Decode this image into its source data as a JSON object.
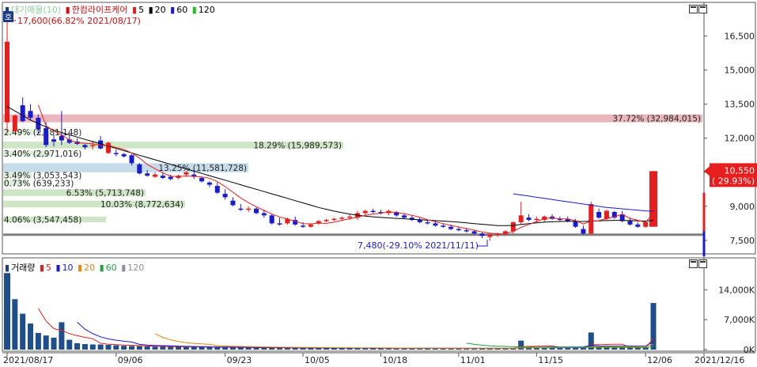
{
  "chart_data": [
    {
      "type": "candlestick",
      "title": "한컴라이프케어",
      "legend": {
        "prefix_label": "대기매물(10)",
        "name": "한컴라이프케어",
        "ma": [
          {
            "label": "5",
            "color": "#e02020"
          },
          {
            "label": "20",
            "color": "#000000"
          },
          {
            "label": "60",
            "color": "#1a1ad0"
          },
          {
            "label": "120",
            "color": "#20c020"
          }
        ]
      },
      "high_note": "17,600(66.82% 2021/08/17)",
      "low_note": "7,480(-29.10% 2021/11/11)",
      "current_price": "10,550",
      "current_change": "( 29.93%)",
      "y_ticks": [
        "16,500",
        "15,000",
        "13,500",
        "12,000",
        "10,500",
        "9,000",
        "7,500"
      ],
      "y_tick_values": [
        16500,
        15000,
        13500,
        12000,
        10500,
        9000,
        7500
      ],
      "ylim": [
        6800,
        17600
      ],
      "x_ticks": [
        "2021/08/17",
        "09/06",
        "09/23",
        "10/05",
        "10/18",
        "11/01",
        "11/15",
        "12/06",
        "2021/12/16"
      ],
      "volume_profile": [
        {
          "low": 12700,
          "high": 13050,
          "text": "37.72% (32,984,015)",
          "label_align": "right",
          "color": "#eab8bc"
        },
        {
          "low": 11550,
          "high": 11850,
          "text": "18.29% (15,989,573)",
          "label_align": "right",
          "color": "#cfe6c6"
        },
        {
          "low": 10500,
          "high": 10900,
          "text": "13.25% (11,581,728)",
          "label_align": "right",
          "color": "#c6dcea"
        },
        {
          "low": 12150,
          "high": 12400,
          "text": "2.49% (2,181,148)",
          "label_align": "left",
          "color": "#dfeeda"
        },
        {
          "low": 11200,
          "high": 11450,
          "text": "3.40% (2,971,016)",
          "label_align": "left",
          "color": "#dfeeda"
        },
        {
          "low": 10250,
          "high": 10500,
          "text": "3.49% (3,053,543)",
          "label_align": "left",
          "color": "#dfeeda"
        },
        {
          "low": 9900,
          "high": 10150,
          "text": "0.73% (639,233)",
          "label_align": "left",
          "color": "#dfeeda"
        },
        {
          "low": 9450,
          "high": 9750,
          "text": "6.53% (5,713,748)",
          "label_align": "right",
          "color": "#cfe6c6"
        },
        {
          "low": 8950,
          "high": 9250,
          "text": "10.03% (8,772,634)",
          "label_align": "right",
          "color": "#cfe6c6"
        },
        {
          "low": 8300,
          "high": 8550,
          "text": "4.06% (3,547,458)",
          "label_align": "left",
          "color": "#cfe6c6"
        }
      ],
      "support_line": 7750,
      "candles": [
        {
          "o": 12700,
          "h": 17600,
          "l": 12300,
          "c": 16250
        },
        {
          "o": 12300,
          "h": 13050,
          "l": 12300,
          "c": 13000
        },
        {
          "o": 13450,
          "h": 13800,
          "l": 12700,
          "c": 12750
        },
        {
          "o": 13200,
          "h": 13500,
          "l": 12800,
          "c": 12900
        },
        {
          "o": 12900,
          "h": 13050,
          "l": 12200,
          "c": 12400
        },
        {
          "o": 12450,
          "h": 12700,
          "l": 11600,
          "c": 11700
        },
        {
          "o": 11950,
          "h": 12150,
          "l": 11650,
          "c": 11850
        },
        {
          "o": 12100,
          "h": 13200,
          "l": 11700,
          "c": 11900
        },
        {
          "o": 11950,
          "h": 12150,
          "l": 11750,
          "c": 11800
        },
        {
          "o": 11850,
          "h": 12000,
          "l": 11700,
          "c": 11750
        },
        {
          "o": 11700,
          "h": 11750,
          "l": 11500,
          "c": 11600
        },
        {
          "o": 11650,
          "h": 11850,
          "l": 11500,
          "c": 11700
        },
        {
          "o": 11900,
          "h": 12100,
          "l": 11500,
          "c": 11550
        },
        {
          "o": 11350,
          "h": 11850,
          "l": 11300,
          "c": 11800
        },
        {
          "o": 11350,
          "h": 11500,
          "l": 11200,
          "c": 11300
        },
        {
          "o": 11300,
          "h": 11350,
          "l": 11150,
          "c": 11200
        },
        {
          "o": 11250,
          "h": 11300,
          "l": 10800,
          "c": 10900
        },
        {
          "o": 10850,
          "h": 10900,
          "l": 10400,
          "c": 10450
        },
        {
          "o": 10450,
          "h": 10600,
          "l": 10300,
          "c": 10350
        },
        {
          "o": 10300,
          "h": 10500,
          "l": 10250,
          "c": 10400
        },
        {
          "o": 10350,
          "h": 10500,
          "l": 10200,
          "c": 10250
        },
        {
          "o": 10300,
          "h": 10400,
          "l": 10150,
          "c": 10200
        },
        {
          "o": 10250,
          "h": 10400,
          "l": 10200,
          "c": 10350
        },
        {
          "o": 10400,
          "h": 10550,
          "l": 10300,
          "c": 10500
        },
        {
          "o": 10400,
          "h": 10600,
          "l": 10200,
          "c": 10300
        },
        {
          "o": 10250,
          "h": 10300,
          "l": 10050,
          "c": 10100
        },
        {
          "o": 10050,
          "h": 10100,
          "l": 9850,
          "c": 9950
        },
        {
          "o": 9900,
          "h": 10050,
          "l": 9550,
          "c": 9600
        },
        {
          "o": 9550,
          "h": 9750,
          "l": 9300,
          "c": 9400
        },
        {
          "o": 9250,
          "h": 9400,
          "l": 9000,
          "c": 9050
        },
        {
          "o": 8900,
          "h": 9100,
          "l": 8800,
          "c": 8850
        },
        {
          "o": 8850,
          "h": 9000,
          "l": 8750,
          "c": 8900
        },
        {
          "o": 8900,
          "h": 8950,
          "l": 8650,
          "c": 8700
        },
        {
          "o": 8700,
          "h": 8850,
          "l": 8500,
          "c": 8600
        },
        {
          "o": 8600,
          "h": 8650,
          "l": 8200,
          "c": 8250
        },
        {
          "o": 8250,
          "h": 8500,
          "l": 8150,
          "c": 8200
        },
        {
          "o": 8250,
          "h": 8500,
          "l": 8200,
          "c": 8450
        },
        {
          "o": 8400,
          "h": 8550,
          "l": 8150,
          "c": 8200
        },
        {
          "o": 8150,
          "h": 8300,
          "l": 8050,
          "c": 8100
        },
        {
          "o": 8100,
          "h": 8250,
          "l": 8050,
          "c": 8200
        },
        {
          "o": 8250,
          "h": 8400,
          "l": 8200,
          "c": 8350
        },
        {
          "o": 8350,
          "h": 8450,
          "l": 8300,
          "c": 8400
        },
        {
          "o": 8400,
          "h": 8500,
          "l": 8350,
          "c": 8450
        },
        {
          "o": 8450,
          "h": 8550,
          "l": 8350,
          "c": 8500
        },
        {
          "o": 8500,
          "h": 8650,
          "l": 8400,
          "c": 8550
        },
        {
          "o": 8500,
          "h": 8800,
          "l": 8400,
          "c": 8700
        },
        {
          "o": 8700,
          "h": 8850,
          "l": 8600,
          "c": 8800
        },
        {
          "o": 8800,
          "h": 8900,
          "l": 8700,
          "c": 8750
        },
        {
          "o": 8750,
          "h": 8850,
          "l": 8650,
          "c": 8700
        },
        {
          "o": 8700,
          "h": 8850,
          "l": 8600,
          "c": 8800
        },
        {
          "o": 8750,
          "h": 8800,
          "l": 8550,
          "c": 8600
        },
        {
          "o": 8600,
          "h": 8700,
          "l": 8450,
          "c": 8500
        },
        {
          "o": 8500,
          "h": 8600,
          "l": 8350,
          "c": 8400
        },
        {
          "o": 8400,
          "h": 8500,
          "l": 8250,
          "c": 8300
        },
        {
          "o": 8300,
          "h": 8400,
          "l": 8200,
          "c": 8250
        },
        {
          "o": 8250,
          "h": 8350,
          "l": 8100,
          "c": 8150
        },
        {
          "o": 8150,
          "h": 8250,
          "l": 8050,
          "c": 8100
        },
        {
          "o": 8100,
          "h": 8200,
          "l": 7950,
          "c": 8000
        },
        {
          "o": 8000,
          "h": 8100,
          "l": 7900,
          "c": 7950
        },
        {
          "o": 7950,
          "h": 8050,
          "l": 7850,
          "c": 7900
        },
        {
          "o": 7900,
          "h": 7950,
          "l": 7750,
          "c": 7800
        },
        {
          "o": 7800,
          "h": 7850,
          "l": 7600,
          "c": 7700
        },
        {
          "o": 7650,
          "h": 7800,
          "l": 7480,
          "c": 7750
        },
        {
          "o": 7750,
          "h": 7850,
          "l": 7650,
          "c": 7800
        },
        {
          "o": 7800,
          "h": 7950,
          "l": 7700,
          "c": 7900
        },
        {
          "o": 7900,
          "h": 8350,
          "l": 7800,
          "c": 8300
        },
        {
          "o": 8300,
          "h": 9200,
          "l": 8200,
          "c": 8600
        },
        {
          "o": 8500,
          "h": 8650,
          "l": 8350,
          "c": 8400
        },
        {
          "o": 8400,
          "h": 8550,
          "l": 8300,
          "c": 8450
        },
        {
          "o": 8400,
          "h": 8600,
          "l": 8300,
          "c": 8550
        },
        {
          "o": 8550,
          "h": 8650,
          "l": 8400,
          "c": 8450
        },
        {
          "o": 8450,
          "h": 8550,
          "l": 8350,
          "c": 8400
        },
        {
          "o": 8450,
          "h": 8550,
          "l": 8300,
          "c": 8350
        },
        {
          "o": 8350,
          "h": 8450,
          "l": 8050,
          "c": 8100
        },
        {
          "o": 8000,
          "h": 8150,
          "l": 7750,
          "c": 7800
        },
        {
          "o": 7800,
          "h": 9200,
          "l": 7750,
          "c": 9100
        },
        {
          "o": 8750,
          "h": 8900,
          "l": 8450,
          "c": 8500
        },
        {
          "o": 8450,
          "h": 8850,
          "l": 8400,
          "c": 8800
        },
        {
          "o": 8750,
          "h": 8800,
          "l": 8450,
          "c": 8500
        },
        {
          "o": 8650,
          "h": 8800,
          "l": 8300,
          "c": 8350
        },
        {
          "o": 8350,
          "h": 8500,
          "l": 8150,
          "c": 8200
        },
        {
          "o": 8200,
          "h": 8300,
          "l": 8050,
          "c": 8100
        },
        {
          "o": 8100,
          "h": 8350,
          "l": 8050,
          "c": 8300
        },
        {
          "o": 8100,
          "h": 10550,
          "l": 8100,
          "c": 10550
        }
      ],
      "ma20": [
        13400,
        13200,
        13000,
        12800,
        12650,
        12500,
        12350,
        12250,
        12150,
        12050,
        11950,
        11850,
        11750,
        11650,
        11550,
        11450,
        11350,
        11250,
        11150,
        11050,
        10950,
        10850,
        10750,
        10650,
        10550,
        10450,
        10350,
        10250,
        10150,
        10050,
        9950,
        9850,
        9750,
        9650,
        9550,
        9450,
        9350,
        9250,
        9150,
        9050,
        8950,
        8870,
        8790,
        8720,
        8660,
        8610,
        8570,
        8540,
        8510,
        8490,
        8470,
        8450,
        8430,
        8410,
        8390,
        8370,
        8350,
        8330,
        8300,
        8270,
        8240,
        8210,
        8180,
        8150,
        8150,
        8160,
        8200,
        8240,
        8270,
        8300,
        8320,
        8330,
        8340,
        8340,
        8330,
        8350,
        8360,
        8370,
        8380,
        8380,
        8370,
        8360,
        8350,
        8380
      ],
      "ma60": [
        null,
        null,
        null,
        null,
        null,
        null,
        null,
        null,
        null,
        null,
        null,
        null,
        null,
        null,
        null,
        null,
        null,
        null,
        null,
        null,
        null,
        null,
        null,
        null,
        null,
        null,
        null,
        null,
        null,
        null,
        null,
        null,
        null,
        null,
        null,
        null,
        null,
        null,
        null,
        null,
        null,
        null,
        null,
        null,
        null,
        null,
        null,
        null,
        null,
        null,
        null,
        null,
        null,
        null,
        null,
        null,
        null,
        null,
        null,
        null,
        null,
        null,
        null,
        null,
        null,
        9550,
        9500,
        9450,
        9400,
        9350,
        9300,
        9250,
        9200,
        9150,
        9100,
        9050,
        9000,
        8950,
        8920,
        8890,
        8860,
        8830,
        8800,
        8780
      ]
    },
    {
      "type": "bar",
      "title": "거래량",
      "legend": {
        "name": "거래량",
        "ma": [
          {
            "label": "5",
            "color": "#e02020"
          },
          {
            "label": "10",
            "color": "#1a1ad0"
          },
          {
            "label": "20",
            "color": "#e08a10"
          },
          {
            "label": "60",
            "color": "#20a040"
          },
          {
            "label": "120",
            "color": "#909090"
          }
        ]
      },
      "y_ticks": [
        "14,000K",
        "7,000K",
        "0K"
      ],
      "y_tick_values": [
        14000,
        7000,
        0
      ],
      "ylim": [
        0,
        18500
      ],
      "unit": "K",
      "values": [
        17900,
        11800,
        8400,
        6100,
        3900,
        3300,
        2800,
        6400,
        2300,
        1500,
        1300,
        1200,
        1200,
        1100,
        1000,
        900,
        850,
        800,
        750,
        700,
        700,
        650,
        650,
        600,
        600,
        600,
        550,
        550,
        500,
        500,
        500,
        450,
        450,
        450,
        400,
        400,
        400,
        400,
        380,
        380,
        380,
        360,
        360,
        350,
        350,
        350,
        340,
        340,
        330,
        330,
        320,
        320,
        310,
        310,
        300,
        300,
        300,
        300,
        300,
        290,
        290,
        290,
        290,
        290,
        300,
        350,
        2100,
        700,
        500,
        500,
        450,
        450,
        420,
        400,
        400,
        4000,
        650,
        600,
        520,
        500,
        480,
        460,
        450,
        10900
      ]
    }
  ]
}
